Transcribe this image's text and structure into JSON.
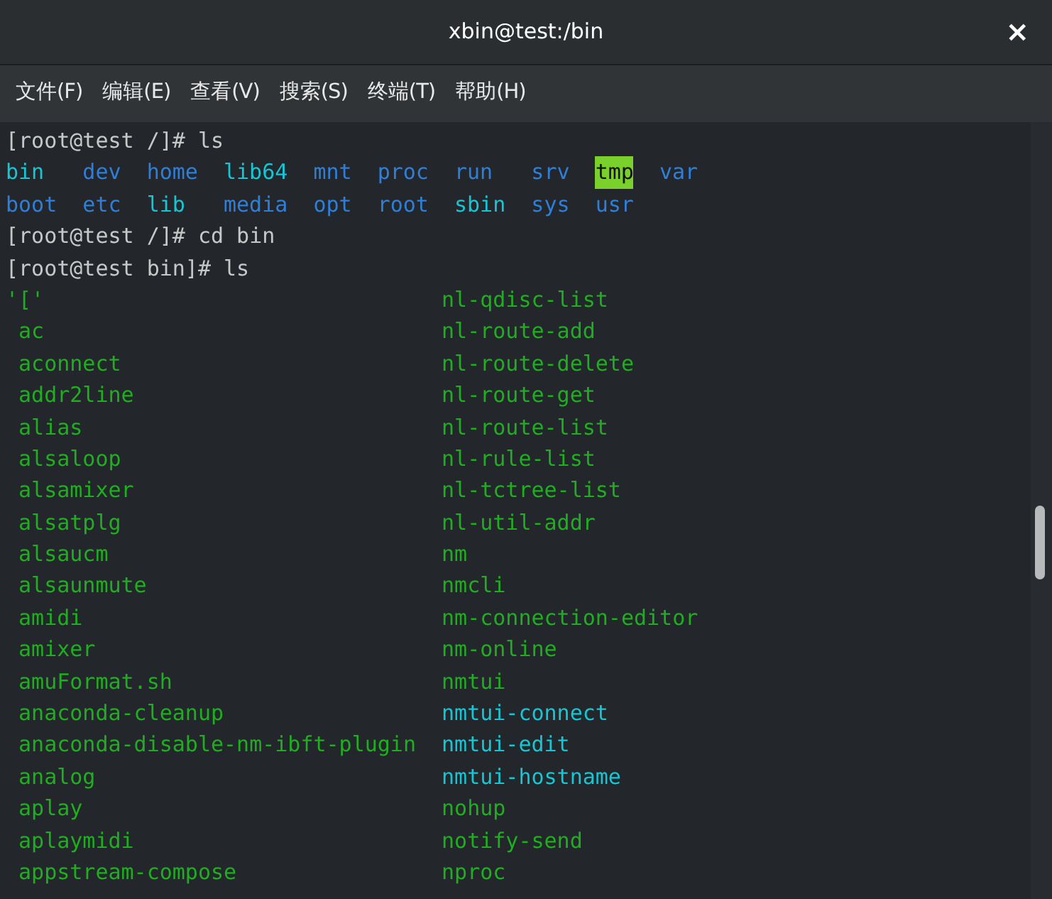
{
  "window": {
    "title": "xbin@test:/bin",
    "close": "×"
  },
  "menu": [
    "文件(F)",
    "编辑(E)",
    "查看(V)",
    "搜索(S)",
    "终端(T)",
    "帮助(H)"
  ],
  "terminal": [
    {
      "kind": "command",
      "text": "[root@test /]# ls"
    },
    {
      "kind": "columns",
      "entries": [
        {
          "text": "bin",
          "kind": "link"
        },
        {
          "text": "dev",
          "kind": "dir"
        },
        {
          "text": "home",
          "kind": "dir"
        },
        {
          "text": "lib64",
          "kind": "link"
        },
        {
          "text": "mnt",
          "kind": "dir"
        },
        {
          "text": "proc",
          "kind": "dir"
        },
        {
          "text": "run",
          "kind": "dir"
        },
        {
          "text": "srv",
          "kind": "dir"
        },
        {
          "text": "tmp",
          "kind": "sticky"
        },
        {
          "text": "var",
          "kind": "dir"
        }
      ]
    },
    {
      "kind": "columns",
      "entries": [
        {
          "text": "boot",
          "kind": "dir"
        },
        {
          "text": "etc",
          "kind": "dir"
        },
        {
          "text": "lib",
          "kind": "link"
        },
        {
          "text": "media",
          "kind": "dir"
        },
        {
          "text": "opt",
          "kind": "dir"
        },
        {
          "text": "root",
          "kind": "dir"
        },
        {
          "text": "sbin",
          "kind": "link"
        },
        {
          "text": "sys",
          "kind": "dir"
        },
        {
          "text": "usr",
          "kind": "dir"
        }
      ]
    },
    {
      "kind": "command",
      "text": "[root@test /]# cd bin"
    },
    {
      "kind": "command",
      "text": "[root@test bin]# ls"
    },
    {
      "kind": "columns",
      "entries": [
        {
          "text": "'['",
          "kind": "exec"
        },
        {
          "text": "nl-qdisc-list",
          "kind": "exec"
        }
      ]
    },
    {
      "kind": "columns",
      "entries": [
        {
          "text": " ac",
          "kind": "exec"
        },
        {
          "text": "nl-route-add",
          "kind": "exec"
        }
      ]
    },
    {
      "kind": "columns",
      "entries": [
        {
          "text": " aconnect",
          "kind": "exec"
        },
        {
          "text": "nl-route-delete",
          "kind": "exec"
        }
      ]
    },
    {
      "kind": "columns",
      "entries": [
        {
          "text": " addr2line",
          "kind": "exec"
        },
        {
          "text": "nl-route-get",
          "kind": "exec"
        }
      ]
    },
    {
      "kind": "columns",
      "entries": [
        {
          "text": " alias",
          "kind": "exec"
        },
        {
          "text": "nl-route-list",
          "kind": "exec"
        }
      ]
    },
    {
      "kind": "columns",
      "entries": [
        {
          "text": " alsaloop",
          "kind": "exec"
        },
        {
          "text": "nl-rule-list",
          "kind": "exec"
        }
      ]
    },
    {
      "kind": "columns",
      "entries": [
        {
          "text": " alsamixer",
          "kind": "exec"
        },
        {
          "text": "nl-tctree-list",
          "kind": "exec"
        }
      ]
    },
    {
      "kind": "columns",
      "entries": [
        {
          "text": " alsatplg",
          "kind": "exec"
        },
        {
          "text": "nl-util-addr",
          "kind": "exec"
        }
      ]
    },
    {
      "kind": "columns",
      "entries": [
        {
          "text": " alsaucm",
          "kind": "exec"
        },
        {
          "text": "nm",
          "kind": "exec"
        }
      ]
    },
    {
      "kind": "columns",
      "entries": [
        {
          "text": " alsaunmute",
          "kind": "exec"
        },
        {
          "text": "nmcli",
          "kind": "exec"
        }
      ]
    },
    {
      "kind": "columns",
      "entries": [
        {
          "text": " amidi",
          "kind": "exec"
        },
        {
          "text": "nm-connection-editor",
          "kind": "exec"
        }
      ]
    },
    {
      "kind": "columns",
      "entries": [
        {
          "text": " amixer",
          "kind": "exec"
        },
        {
          "text": "nm-online",
          "kind": "exec"
        }
      ]
    },
    {
      "kind": "columns",
      "entries": [
        {
          "text": " amuFormat.sh",
          "kind": "exec"
        },
        {
          "text": "nmtui",
          "kind": "exec"
        }
      ]
    },
    {
      "kind": "columns",
      "entries": [
        {
          "text": " anaconda-cleanup",
          "kind": "exec"
        },
        {
          "text": "nmtui-connect",
          "kind": "link"
        }
      ]
    },
    {
      "kind": "columns",
      "entries": [
        {
          "text": " anaconda-disable-nm-ibft-plugin",
          "kind": "exec"
        },
        {
          "text": "nmtui-edit",
          "kind": "link"
        }
      ]
    },
    {
      "kind": "columns",
      "entries": [
        {
          "text": " analog",
          "kind": "exec"
        },
        {
          "text": "nmtui-hostname",
          "kind": "link"
        }
      ]
    },
    {
      "kind": "columns",
      "entries": [
        {
          "text": " aplay",
          "kind": "exec"
        },
        {
          "text": "nohup",
          "kind": "exec"
        }
      ]
    },
    {
      "kind": "columns",
      "entries": [
        {
          "text": " aplaymidi",
          "kind": "exec"
        },
        {
          "text": "notify-send",
          "kind": "exec"
        }
      ]
    },
    {
      "kind": "columns",
      "entries": [
        {
          "text": " appstream-compose",
          "kind": "exec"
        },
        {
          "text": "nproc",
          "kind": "exec"
        }
      ]
    }
  ]
}
